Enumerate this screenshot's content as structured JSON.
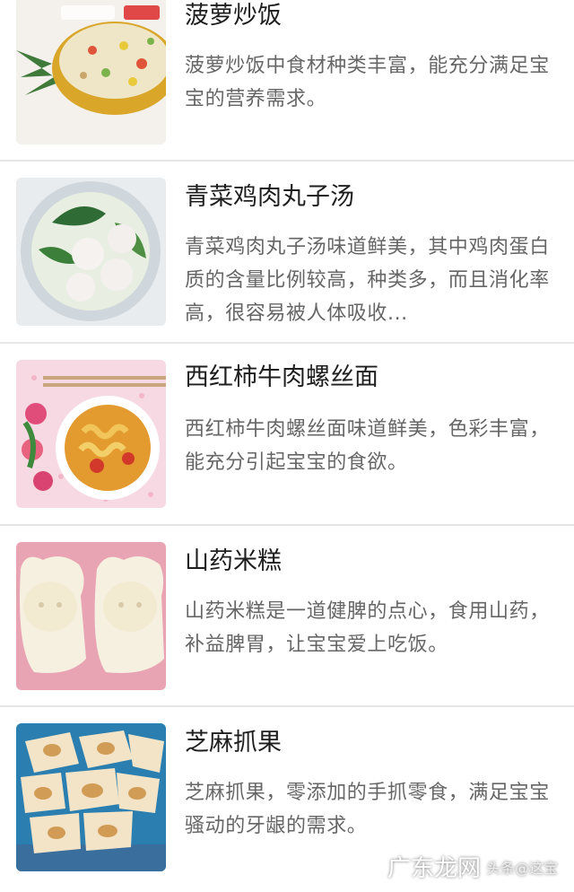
{
  "recipes": [
    {
      "title": "菠萝炒饭",
      "desc": "菠萝炒饭中食材种类丰富，能充分满足宝宝的营养需求。",
      "image": "pineapple-fried-rice"
    },
    {
      "title": "青菜鸡肉丸子汤",
      "desc": "青菜鸡肉丸子汤味道鲜美，其中鸡肉蛋白质的含量比例较高，种类多，而且消化率高，很容易被人体吸收...",
      "image": "meatball-soup"
    },
    {
      "title": "西红柿牛肉螺丝面",
      "desc": "西红柿牛肉螺丝面味道鲜美，色彩丰富，能充分引起宝宝的食欲。",
      "image": "tomato-beef-fusilli"
    },
    {
      "title": "山药米糕",
      "desc": "山药米糕是一道健脾的点心，食用山药，补益脾胃，让宝宝爱上吃饭。",
      "image": "yam-rice-cake"
    },
    {
      "title": "芝麻抓果",
      "desc": "芝麻抓果，零添加的手抓零食，满足宝宝骚动的牙龈的需求。",
      "image": "sesame-snack"
    }
  ],
  "watermark": {
    "text": "广东龙网",
    "sub": "头条@这宝"
  }
}
